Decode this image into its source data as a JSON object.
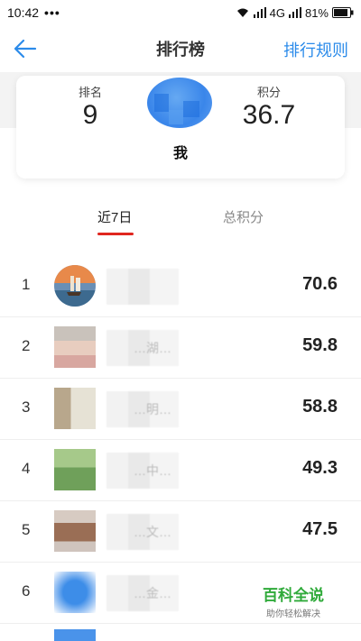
{
  "status_bar": {
    "time": "10:42",
    "dots": "•••",
    "network": "4G",
    "battery": "81%"
  },
  "header": {
    "title": "排行榜",
    "rules_label": "排行规则"
  },
  "summary": {
    "rank_label": "排名",
    "rank_value": "9",
    "score_label": "积分",
    "score_value": "36.7",
    "self_name": "我"
  },
  "tabs": {
    "week": "近7日",
    "total": "总积分",
    "active": "week"
  },
  "rankings": [
    {
      "rank": "1",
      "name": "",
      "score": "70.6"
    },
    {
      "rank": "2",
      "name": "…湖…",
      "score": "59.8"
    },
    {
      "rank": "3",
      "name": "…明…",
      "score": "58.8"
    },
    {
      "rank": "4",
      "name": "…中…",
      "score": "49.3"
    },
    {
      "rank": "5",
      "name": "…文…",
      "score": "47.5"
    },
    {
      "rank": "6",
      "name": "…金…",
      "score": ""
    }
  ],
  "watermark": {
    "title": "百科全说",
    "subtitle": "助你轻松解决"
  },
  "colors": {
    "accent": "#2b8bea",
    "tab_underline": "#e0261f",
    "watermark_green": "#2faa3a"
  }
}
